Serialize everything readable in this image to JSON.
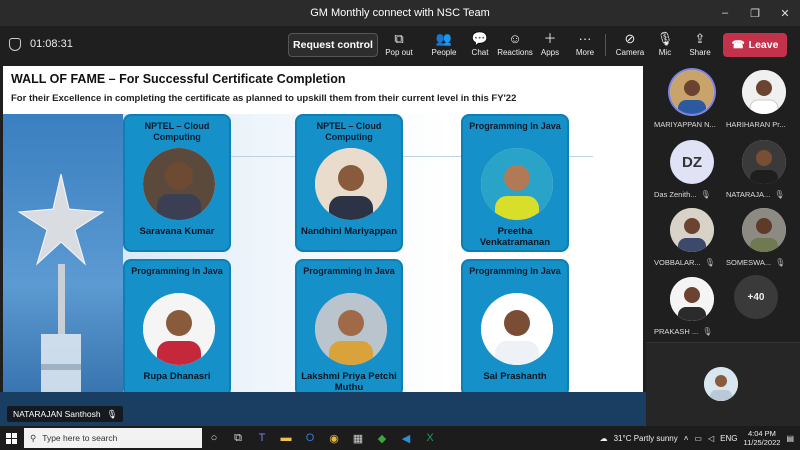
{
  "window": {
    "title": "GM Monthly connect with NSC Team",
    "controls": [
      "–",
      "❐",
      "✕"
    ]
  },
  "toolbar": {
    "timer": "01:08:31",
    "request_control": "Request control",
    "buttons": [
      {
        "label": "Pop out",
        "icon": "popout-icon"
      },
      {
        "label": "People",
        "icon": "people-icon"
      },
      {
        "label": "Chat",
        "icon": "chat-icon"
      },
      {
        "label": "Reactions",
        "icon": "reactions-icon"
      },
      {
        "label": "Apps",
        "icon": "apps-icon"
      },
      {
        "label": "More",
        "icon": "more-icon"
      },
      {
        "label": "Camera",
        "icon": "camera-off-icon"
      },
      {
        "label": "Mic",
        "icon": "mic-off-icon"
      },
      {
        "label": "Share",
        "icon": "share-icon"
      }
    ],
    "leave": "Leave"
  },
  "slide": {
    "title": "WALL OF FAME – For Successful Certificate Completion",
    "subtitle": "For their Excellence in completing the certificate as planned to upskill them from their current level in this FY'22",
    "cards": [
      {
        "course": "NPTEL – Cloud Computing",
        "name": "Saravana Kumar"
      },
      {
        "course": "NPTEL – Cloud Computing",
        "name": "Nandhini Mariyappan"
      },
      {
        "course": "Programming In Java",
        "name": "Preetha Venkatramanan"
      },
      {
        "course": "Programming In Java",
        "name": "Rupa Dhanasri"
      },
      {
        "course": "Programming In Java",
        "name": "Lakshmi Priya Petchi Muthu"
      },
      {
        "course": "Programming In Java",
        "name": "Sai Prashanth"
      }
    ]
  },
  "presenter_label": "NATARAJAN Santhosh",
  "participants": [
    {
      "name": "MARIYAPPAN N...",
      "initials": ""
    },
    {
      "name": "HARIHARAN Pr...",
      "initials": ""
    },
    {
      "name": "Das Zenith...",
      "initials": "DZ"
    },
    {
      "name": "NATARAJA...",
      "initials": ""
    },
    {
      "name": "VOBBALAR...",
      "initials": ""
    },
    {
      "name": "SOMESWA...",
      "initials": ""
    },
    {
      "name": "PRAKASH ...",
      "initials": ""
    }
  ],
  "more_participants": "+40",
  "taskbar": {
    "search_placeholder": "Type here to search",
    "weather": "31°C  Partly sunny",
    "language": "ENG",
    "time": "4:04 PM",
    "date": "11/25/2022"
  }
}
